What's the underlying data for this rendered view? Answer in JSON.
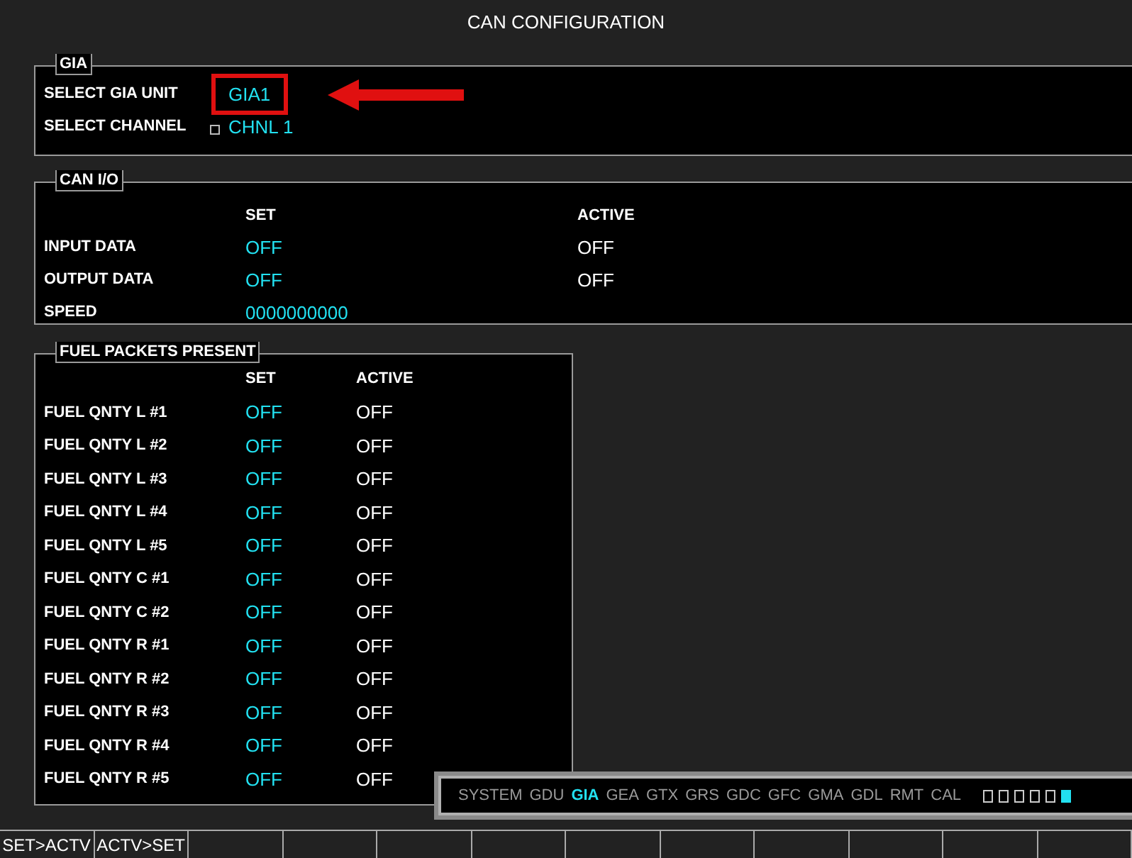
{
  "title": "CAN CONFIGURATION",
  "gia": {
    "legend": "GIA",
    "rows": [
      {
        "label": "SELECT GIA UNIT",
        "value": "GIA1",
        "highlighted": true
      },
      {
        "label": "SELECT CHANNEL",
        "value": "CHNL 1",
        "highlighted": false
      }
    ]
  },
  "can_io": {
    "legend": "CAN I/O",
    "set_heading": "SET",
    "active_heading": "ACTIVE",
    "rows": [
      {
        "label": "INPUT DATA",
        "set": "OFF",
        "active": "OFF"
      },
      {
        "label": "OUTPUT DATA",
        "set": "OFF",
        "active": "OFF"
      },
      {
        "label": "SPEED",
        "set": "0000000000"
      }
    ]
  },
  "fuel": {
    "legend": "FUEL PACKETS PRESENT",
    "set_heading": "SET",
    "active_heading": "ACTIVE",
    "rows": [
      {
        "label": "FUEL QNTY L #1",
        "set": "OFF",
        "active": "OFF"
      },
      {
        "label": "FUEL QNTY L #2",
        "set": "OFF",
        "active": "OFF"
      },
      {
        "label": "FUEL QNTY L #3",
        "set": "OFF",
        "active": "OFF"
      },
      {
        "label": "FUEL QNTY L #4",
        "set": "OFF",
        "active": "OFF"
      },
      {
        "label": "FUEL QNTY L #5",
        "set": "OFF",
        "active": "OFF"
      },
      {
        "label": "FUEL QNTY C #1",
        "set": "OFF",
        "active": "OFF"
      },
      {
        "label": "FUEL QNTY C #2",
        "set": "OFF",
        "active": "OFF"
      },
      {
        "label": "FUEL QNTY R #1",
        "set": "OFF",
        "active": "OFF"
      },
      {
        "label": "FUEL QNTY R #2",
        "set": "OFF",
        "active": "OFF"
      },
      {
        "label": "FUEL QNTY R #3",
        "set": "OFF",
        "active": "OFF"
      },
      {
        "label": "FUEL QNTY R #4",
        "set": "OFF",
        "active": "OFF"
      },
      {
        "label": "FUEL QNTY R #5",
        "set": "OFF",
        "active": "OFF"
      }
    ]
  },
  "page_groups": [
    {
      "label": "SYSTEM",
      "selected": false
    },
    {
      "label": "GDU",
      "selected": false
    },
    {
      "label": "GIA",
      "selected": true
    },
    {
      "label": "GEA",
      "selected": false
    },
    {
      "label": "GTX",
      "selected": false
    },
    {
      "label": "GRS",
      "selected": false
    },
    {
      "label": "GDC",
      "selected": false
    },
    {
      "label": "GFC",
      "selected": false
    },
    {
      "label": "GMA",
      "selected": false
    },
    {
      "label": "GDL",
      "selected": false
    },
    {
      "label": "RMT",
      "selected": false
    },
    {
      "label": "CAL",
      "selected": false
    }
  ],
  "pages": [
    {
      "selected": false
    },
    {
      "selected": false
    },
    {
      "selected": false
    },
    {
      "selected": false
    },
    {
      "selected": false
    },
    {
      "selected": true
    }
  ],
  "softkeys": [
    "SET>ACTV",
    "ACTV>SET"
  ]
}
